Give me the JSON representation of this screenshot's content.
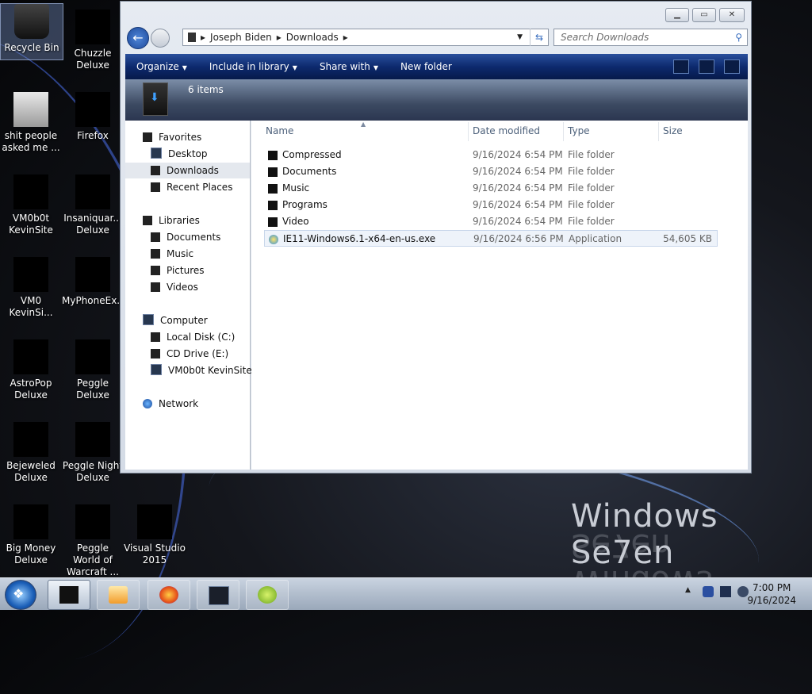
{
  "desktop": {
    "icons": [
      {
        "label": "Recycle Bin"
      },
      {
        "label": "Chuzzle Deluxe"
      },
      {
        "label": "shit people asked me ..."
      },
      {
        "label": "Firefox"
      },
      {
        "label": "VM0b0t KevinSite"
      },
      {
        "label": "Insaniquar... Deluxe"
      },
      {
        "label": "VM0 KevinSi..."
      },
      {
        "label": "MyPhoneEx..."
      },
      {
        "label": "AstroPop Deluxe"
      },
      {
        "label": "Peggle Deluxe"
      },
      {
        "label": "Bejeweled Deluxe"
      },
      {
        "label": "Peggle Night Deluxe"
      },
      {
        "label": "Big Money Deluxe"
      },
      {
        "label": "Peggle World of Warcraft ..."
      },
      {
        "label": "Visual Studio 2015"
      }
    ],
    "wallpaper_brand": "Windows Se7en"
  },
  "explorer": {
    "breadcrumb": [
      "Joseph Biden",
      "Downloads"
    ],
    "search_placeholder": "Search Downloads",
    "toolbar": {
      "organize": "Organize",
      "include": "Include in library",
      "share": "Share with",
      "new_folder": "New folder"
    },
    "item_count": "6 items",
    "nav": {
      "favorites": "Favorites",
      "desktop": "Desktop",
      "downloads": "Downloads",
      "recent": "Recent Places",
      "libraries": "Libraries",
      "documents": "Documents",
      "music": "Music",
      "pictures": "Pictures",
      "videos": "Videos",
      "computer": "Computer",
      "local_disk": "Local Disk (C:)",
      "cd_drive": "CD Drive (E:)",
      "vm_site": "VM0b0t KevinSite",
      "network": "Network"
    },
    "columns": {
      "name": "Name",
      "date": "Date modified",
      "type": "Type",
      "size": "Size"
    },
    "files": [
      {
        "name": "Compressed",
        "date": "9/16/2024 6:54 PM",
        "type": "File folder",
        "size": ""
      },
      {
        "name": "Documents",
        "date": "9/16/2024 6:54 PM",
        "type": "File folder",
        "size": ""
      },
      {
        "name": "Music",
        "date": "9/16/2024 6:54 PM",
        "type": "File folder",
        "size": ""
      },
      {
        "name": "Programs",
        "date": "9/16/2024 6:54 PM",
        "type": "File folder",
        "size": ""
      },
      {
        "name": "Video",
        "date": "9/16/2024 6:54 PM",
        "type": "File folder",
        "size": ""
      },
      {
        "name": "IE11-Windows6.1-x64-en-us.exe",
        "date": "9/16/2024 6:56 PM",
        "type": "Application",
        "size": "54,605 KB"
      }
    ]
  },
  "taskbar": {
    "time": "7:00 PM",
    "date": "9/16/2024"
  }
}
